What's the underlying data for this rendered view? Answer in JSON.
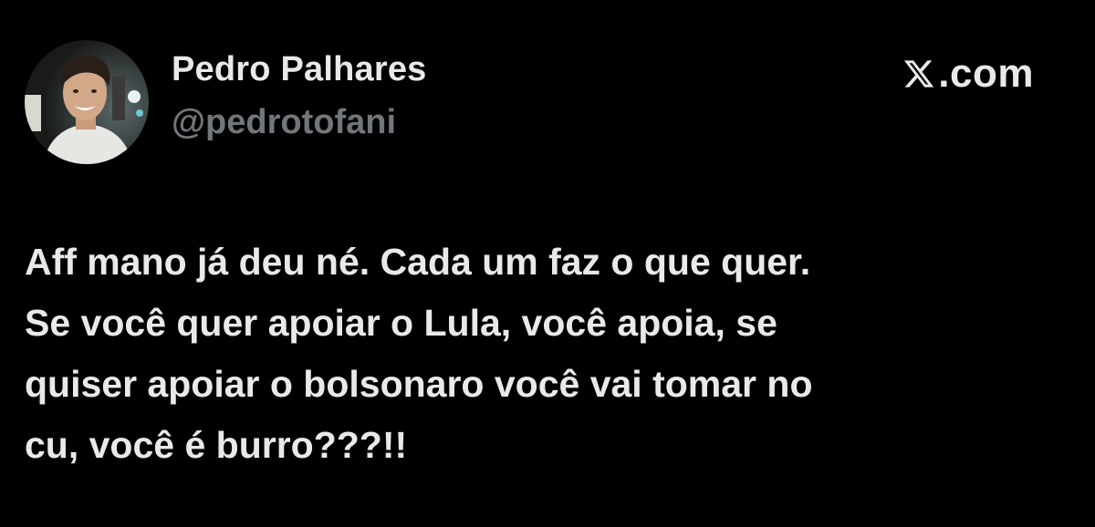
{
  "author": {
    "name": "Pedro Palhares",
    "handle": "@pedrotofani",
    "avatar_icon": "profile-photo"
  },
  "brand": {
    "icon": "x-logo-icon",
    "domain": ".com"
  },
  "tweet": {
    "lines": [
      "Aff mano já deu né. Cada um faz o que quer.",
      "Se você quer apoiar o Lula, você apoia, se",
      "quiser apoiar o bolsonaro você vai tomar no",
      "cu, você é burro???!!"
    ]
  },
  "colors": {
    "background": "#000000",
    "primary_text": "#e7e9ea",
    "secondary_text": "#71767b"
  }
}
